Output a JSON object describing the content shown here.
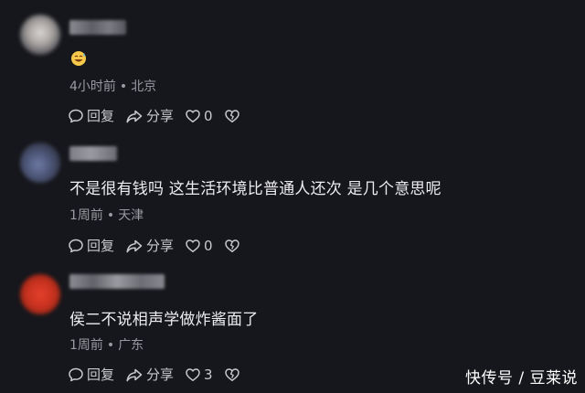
{
  "comments": [
    {
      "content": "",
      "emoji": "grinning-sweat-emoji",
      "time": "4小时前",
      "location": "北京",
      "reply_label": "回复",
      "share_label": "分享",
      "like_count": "0"
    },
    {
      "content": "不是很有钱吗  这生活环境比普通人还次  是几个意思呢",
      "time": "1周前",
      "location": "天津",
      "reply_label": "回复",
      "share_label": "分享",
      "like_count": "0"
    },
    {
      "content": "侯二不说相声学做炸酱面了",
      "time": "1周前",
      "location": "广东",
      "reply_label": "回复",
      "share_label": "分享",
      "like_count": "3"
    }
  ],
  "separator": "•",
  "watermark": "快传号 / 豆莱说",
  "colors": {
    "background": "#16171c",
    "text": "#ededf0",
    "meta": "#9a9ba2",
    "action": "#c8c9cf"
  },
  "icons": [
    "comment-bubble-icon",
    "share-arrow-icon",
    "heart-icon",
    "broken-heart-icon"
  ]
}
